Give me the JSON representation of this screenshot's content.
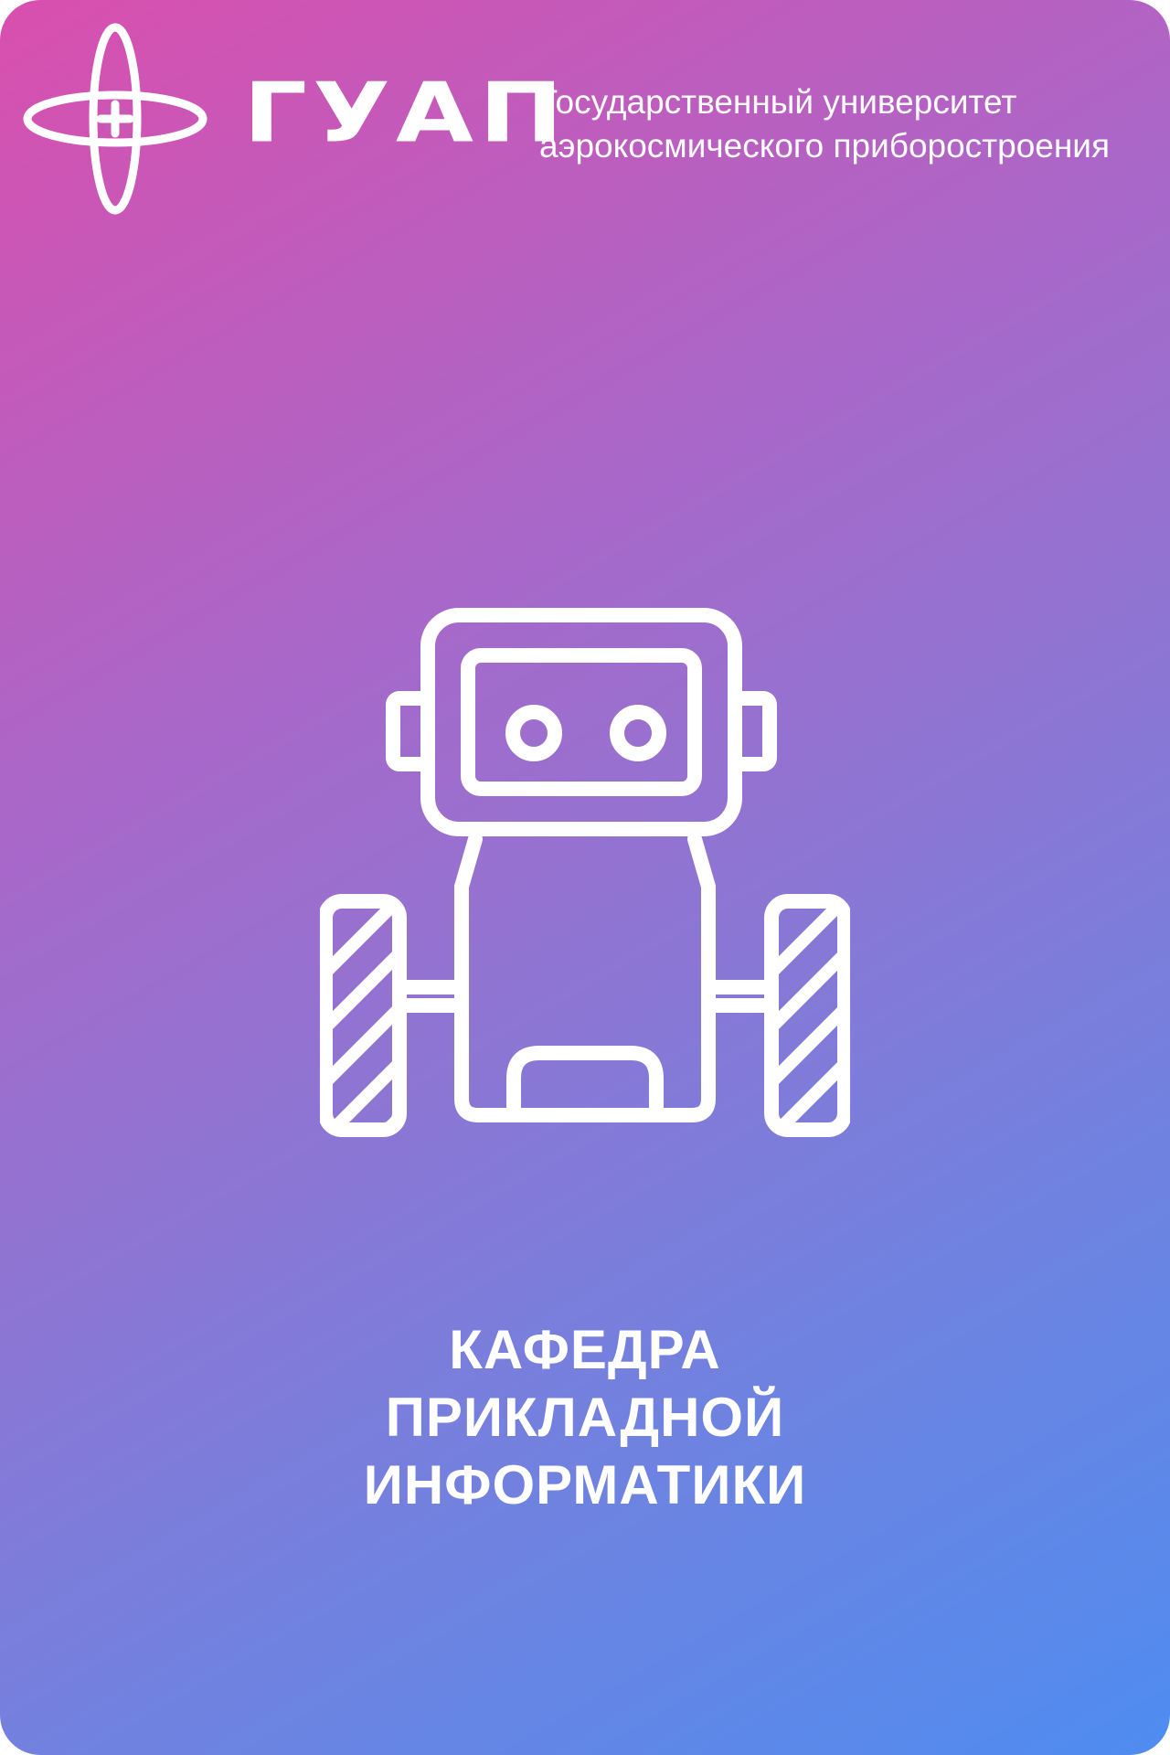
{
  "header": {
    "logo_word": "ГУАП",
    "university_line1": "Государственный университет",
    "university_line2": "аэрокосмического приборостроения"
  },
  "main": {
    "illustration_icon": "robot-icon",
    "department_lines": [
      "КАФЕДРА",
      "ПРИКЛАДНОЙ",
      "ИНФОРМАТИКИ"
    ]
  },
  "colors": {
    "gradient_start": "#d94fae",
    "gradient_end": "#4f8cf0",
    "foreground": "#ffffff"
  }
}
